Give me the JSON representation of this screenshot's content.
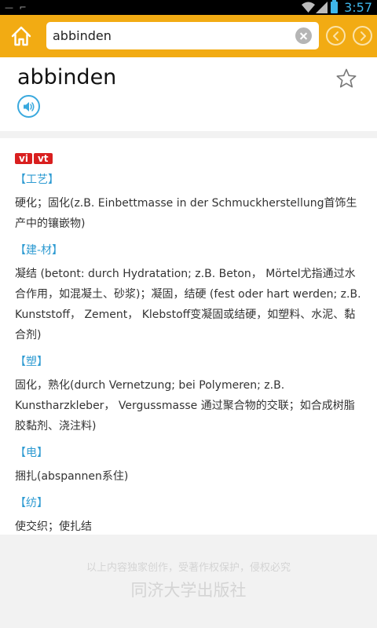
{
  "status_bar": {
    "time": "3:57"
  },
  "search": {
    "query": "abbinden"
  },
  "entry": {
    "headword": "abbinden",
    "pos_tags": [
      "vi",
      "vt"
    ],
    "senses": [
      {
        "domain": "【工艺】",
        "definition": "硬化；固化(z.B. Einbettmasse in der Schmuckherstellung首饰生产中的镶嵌物)"
      },
      {
        "domain": "【建-材】",
        "definition": "凝结 (betont: durch Hydratation; z.B. Beton， Mörtel尤指通过水合作用，如混凝土、砂浆)；凝固，结硬 (fest oder hart werden; z.B. Kunststoff， Zement， Klebstoff变凝固或结硬，如塑料、水泥、黏合剂)"
      },
      {
        "domain": "【塑】",
        "definition": "固化，熟化(durch Vernetzung; bei Polymeren; z.B. Kunstharzkleber， Vergussmasse 通过聚合物的交联；如合成树脂胶黏剂、浇注料)"
      },
      {
        "domain": "【电】",
        "definition": "捆扎(abspannen系住)"
      },
      {
        "domain": "【纺】",
        "definition": "使交织；使扎结"
      }
    ]
  },
  "footer": {
    "notice": "以上内容独家创作，受著作权保护，侵权必究",
    "publisher": "同济大学出版社"
  },
  "colors": {
    "toolbar": "#f2ab13",
    "accent_blue": "#2e9bd2",
    "tag_red": "#d91f1f"
  }
}
